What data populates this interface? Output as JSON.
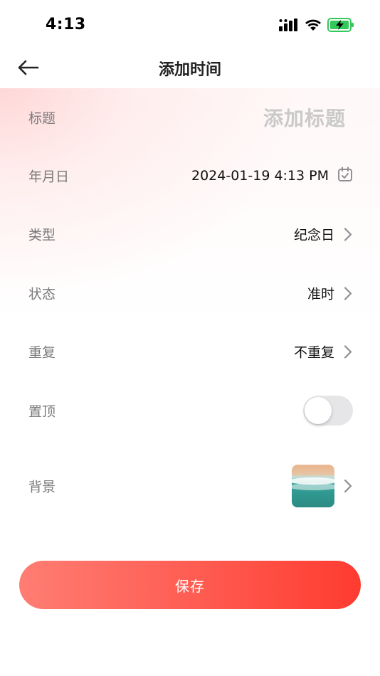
{
  "status_bar": {
    "time": "4:13",
    "icons": [
      "signal-icon",
      "wifi-icon",
      "battery-charging-icon"
    ],
    "battery_color": "#34c759"
  },
  "nav": {
    "title": "添加时间",
    "back_icon": "arrow-left-icon"
  },
  "form": {
    "title": {
      "label": "标题",
      "placeholder": "添加标题"
    },
    "date": {
      "label": "年月日",
      "value": "2024-01-19 4:13 PM",
      "icon": "calendar-check-icon"
    },
    "type": {
      "label": "类型",
      "value": "纪念日"
    },
    "status": {
      "label": "状态",
      "value": "准时"
    },
    "repeat": {
      "label": "重复",
      "value": "不重复"
    },
    "pin": {
      "label": "置顶",
      "toggle_on": false
    },
    "background": {
      "label": "背景",
      "thumbnail": "beach-waves-image"
    }
  },
  "actions": {
    "save_label": "保存"
  },
  "colors": {
    "accent_start": "#ff7d73",
    "accent_end": "#ff3b30",
    "label": "#7a7a7a",
    "placeholder": "#c9c9c9"
  }
}
